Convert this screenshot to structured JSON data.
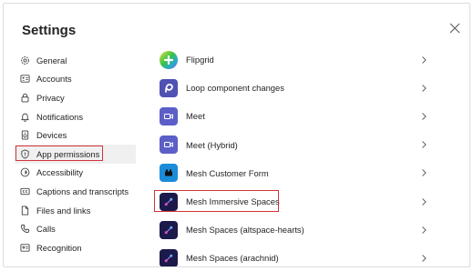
{
  "window": {
    "title": "Settings"
  },
  "nav": {
    "items": [
      {
        "label": "General",
        "icon": "gear-icon"
      },
      {
        "label": "Accounts",
        "icon": "id-card-icon"
      },
      {
        "label": "Privacy",
        "icon": "lock-icon"
      },
      {
        "label": "Notifications",
        "icon": "bell-icon"
      },
      {
        "label": "Devices",
        "icon": "speaker-icon"
      },
      {
        "label": "App permissions",
        "icon": "shield-icon",
        "selected": true
      },
      {
        "label": "Accessibility",
        "icon": "accessibility-icon"
      },
      {
        "label": "Captions and transcripts",
        "icon": "cc-icon"
      },
      {
        "label": "Files and links",
        "icon": "file-icon"
      },
      {
        "label": "Calls",
        "icon": "phone-icon"
      },
      {
        "label": "Recognition",
        "icon": "recognition-icon"
      }
    ]
  },
  "apps": {
    "items": [
      {
        "name": "Flipgrid",
        "icon": "flipgrid-icon"
      },
      {
        "name": "Loop component changes",
        "icon": "loop-icon"
      },
      {
        "name": "Meet",
        "icon": "video-camera-icon"
      },
      {
        "name": "Meet (Hybrid)",
        "icon": "video-camera-icon"
      },
      {
        "name": "Mesh Customer Form",
        "icon": "form-icon"
      },
      {
        "name": "Mesh Immersive Spaces",
        "icon": "mesh-icon",
        "highlighted": true
      },
      {
        "name": "Mesh Spaces (altspace-hearts)",
        "icon": "mesh-icon"
      },
      {
        "name": "Mesh Spaces (arachnid)",
        "icon": "mesh-icon"
      }
    ]
  },
  "colors": {
    "highlight": "#d13438",
    "selected_bg": "#f0f0f0",
    "meet": "#5b5fc7",
    "loop": "#4f52b2",
    "mesh": "#1b1a4a",
    "form": "#1a8cd8"
  }
}
